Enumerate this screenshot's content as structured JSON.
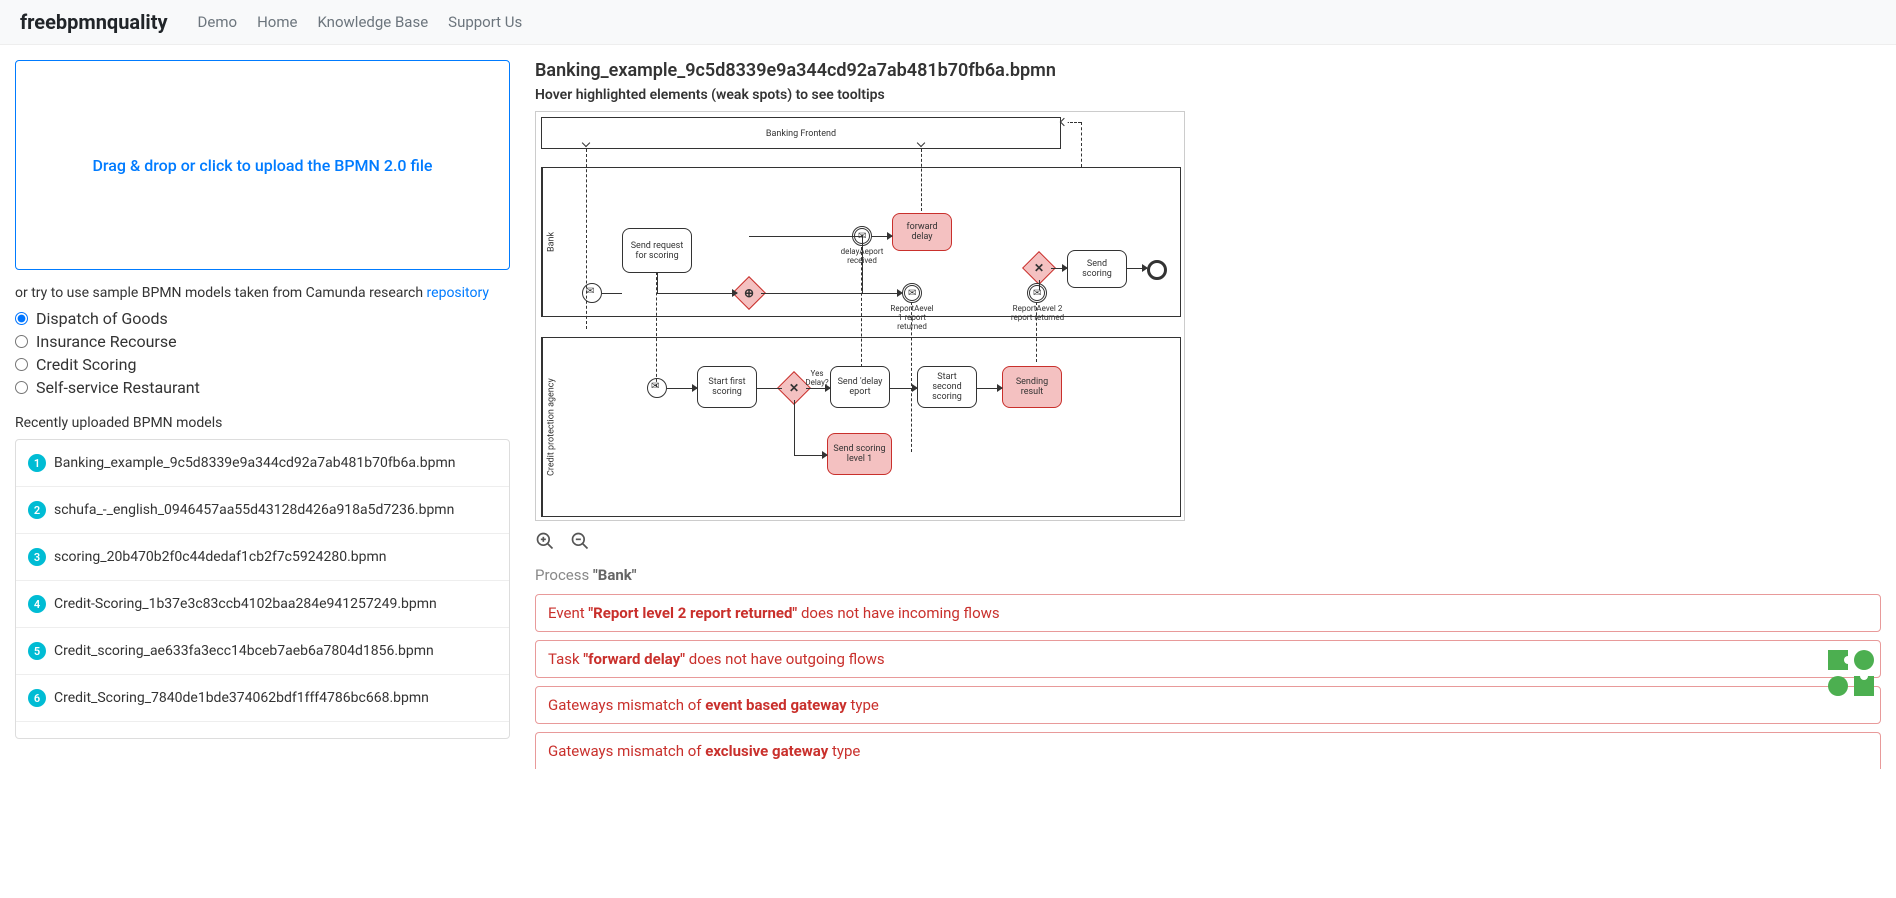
{
  "nav": {
    "brand": "freebpmnquality",
    "links": [
      "Demo",
      "Home",
      "Knowledge Base",
      "Support Us"
    ]
  },
  "dropzone": {
    "label": "Drag & drop or click to upload the BPMN 2.0 file"
  },
  "sample": {
    "prefix": "or try to use sample BPMN models taken from Camunda research ",
    "link": "repository"
  },
  "radios": [
    {
      "label": "Dispatch of Goods",
      "checked": true
    },
    {
      "label": "Insurance Recourse",
      "checked": false
    },
    {
      "label": "Credit Scoring",
      "checked": false
    },
    {
      "label": "Self-service Restaurant",
      "checked": false
    }
  ],
  "recent": {
    "heading": "Recently uploaded BPMN models",
    "items": [
      "Banking_example_9c5d8339e9a344cd92a7ab481b70fb6a.bpmn",
      "schufa_-_english_0946457aa55d43128d426a918a5d7236.bpmn",
      "scoring_20b470b2f0c44dedaf1cb2f7c5924280.bpmn",
      "Credit-Scoring_1b37e3c83ccb4102baa284e941257249.bpmn",
      "Credit_scoring_ae633fa3ecc14bceb7aeb6a7804d1856.bpmn",
      "Credit_Scoring_7840de1bde374062bdf1fff4786bc668.bpmn"
    ]
  },
  "result": {
    "filename": "Banking_example_9c5d8339e9a344cd92a7ab481b70fb6a.bpmn",
    "hint": "Hover highlighted elements (weak spots) to see tooltips",
    "process_prefix": "Process ",
    "process_name": "\"Bank\""
  },
  "diagram": {
    "pool_top": "Banking Frontend",
    "pool_mid": "Bank",
    "pool_bot": "Credit protection agency",
    "tasks": {
      "send_request": "Send request for scoring",
      "forward_delay": "forward delay",
      "send_scoring": "Send scoring",
      "start_first": "Start first scoring",
      "send_delay_report": "Send 'delay eport",
      "start_second": "Start second scoring",
      "sending_result": "Sending result",
      "send_scoring_l1": "Send scoring level 1"
    },
    "events": {
      "delay_report_received": "delayAeport received",
      "report_level1": "ReportAevel 1 report returned",
      "report_level2": "ReportAevel 2 report returned",
      "yes_delay": "Yes Delay?"
    }
  },
  "issues": [
    {
      "p1": "Event ",
      "b": "\"Report level 2 report returned\"",
      "p2": " does not have incoming flows"
    },
    {
      "p1": "Task ",
      "b": "\"forward delay\"",
      "p2": " does not have outgoing flows"
    },
    {
      "p1": "Gateways mismatch of ",
      "b": "event based gateway",
      "p2": " type"
    },
    {
      "p1": "Gateways mismatch of ",
      "b": "exclusive gateway",
      "p2": " type"
    }
  ]
}
